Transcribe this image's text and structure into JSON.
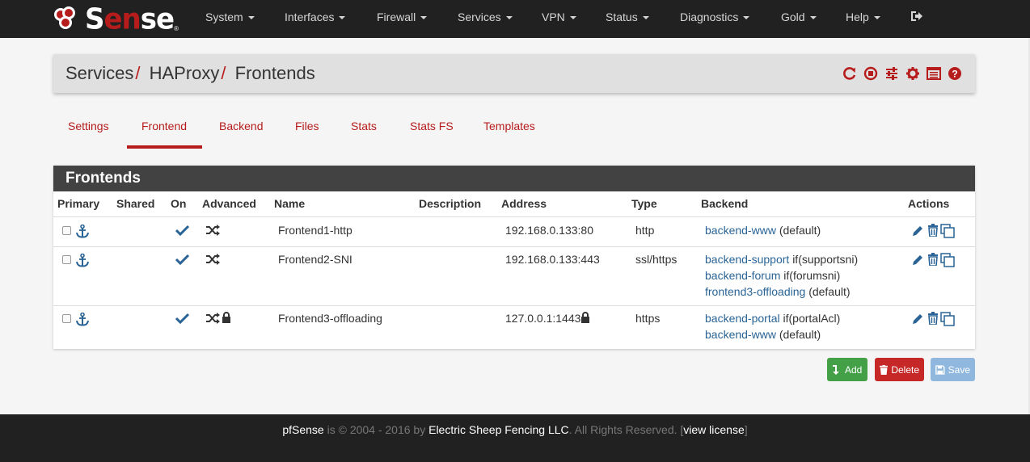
{
  "brand": {
    "name_pre": "S",
    "name_red": "en",
    "name_post": "se",
    "reg": "®"
  },
  "nav": {
    "items": [
      "System",
      "Interfaces",
      "Firewall",
      "Services",
      "VPN",
      "Status",
      "Diagnostics",
      "Gold",
      "Help"
    ]
  },
  "breadcrumb": {
    "level1": "Services",
    "level2": "HAProxy",
    "level3": "Frontends",
    "separator": "/"
  },
  "tabs": [
    "Settings",
    "Frontend",
    "Backend",
    "Files",
    "Stats",
    "Stats FS",
    "Templates"
  ],
  "active_tab": "Frontend",
  "panel": {
    "title": "Frontends",
    "columns": [
      "Primary",
      "Shared",
      "On",
      "Advanced",
      "Name",
      "Description",
      "Address",
      "Type",
      "Backend",
      "Actions"
    ],
    "rows": [
      {
        "name": "Frontend1-http",
        "address": "192.168.0.133:80",
        "type": "http",
        "backends": [
          {
            "link": "backend-www",
            "cond": "(default)"
          }
        ]
      },
      {
        "name": "Frontend2-SNI",
        "address": "192.168.0.133:443",
        "type": "ssl/https",
        "backends": [
          {
            "link": "backend-support",
            "cond": "if(supportsni)"
          },
          {
            "link": "backend-forum",
            "cond": "if(forumsni)"
          },
          {
            "link": "frontend3-offloading",
            "cond": "(default)"
          }
        ]
      },
      {
        "name": "Frontend3-offloading",
        "address": "127.0.0.1:1443",
        "type": "https",
        "backends": [
          {
            "link": "backend-portal",
            "cond": "if(portalAcl)"
          },
          {
            "link": "backend-www",
            "cond": "(default)"
          }
        ]
      }
    ]
  },
  "buttons": {
    "add": "Add",
    "delete": "Delete",
    "save": "Save"
  },
  "footer": {
    "brand": "pfSense",
    "text1": " is © 2004 - 2016 by ",
    "company": "Electric Sheep Fencing LLC",
    "text2": ". All Rights Reserved. [",
    "license": "view license",
    "text3": "]"
  },
  "colors": {
    "accent": "#b71c1c",
    "link": "#2a6496",
    "navbar": "#212121",
    "panel_head": "#424242"
  }
}
